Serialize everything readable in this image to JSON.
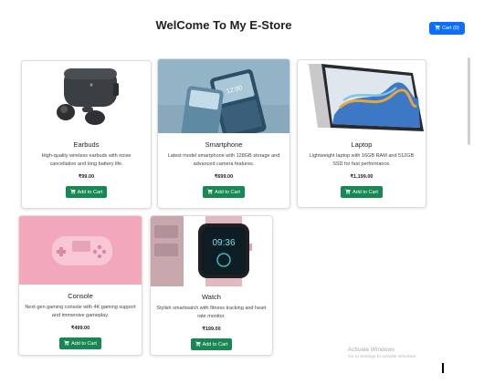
{
  "header": {
    "title": "WelCome To My E-Store",
    "cart_label": "Cart (0)"
  },
  "colors": {
    "primary": "#0d6efd",
    "success": "#198754"
  },
  "products": [
    {
      "title": "Earbuds",
      "description": "High-quality wireless earbuds with noise cancellation and long battery life.",
      "price": "₹99.00",
      "button": "Add to Cart",
      "image": "earbuds-image"
    },
    {
      "title": "Smartphone",
      "description": "Latest model smartphone with 128GB storage and advanced camera features.",
      "price": "₹699.00",
      "button": "Add to Cart",
      "image": "smartphone-image",
      "image_text": "12:00"
    },
    {
      "title": "Laptop",
      "description": "Lightweight laptop with 16GB RAM and 512GB SSD for fast performance.",
      "price": "₹1,199.00",
      "button": "Add to Cart",
      "image": "laptop-image"
    },
    {
      "title": "Console",
      "description": "Next-gen gaming console with 4K gaming support and immersive gameplay.",
      "price": "₹499.00",
      "button": "Add to Cart",
      "image": "console-image"
    },
    {
      "title": "Watch",
      "description": "Stylish smartwatch with fitness tracking and heart rate monitor.",
      "price": "₹199.00",
      "button": "Add to Cart",
      "image": "watch-image",
      "image_text": "09:36"
    }
  ],
  "watermark": {
    "title": "Activate Windows",
    "subtitle": "Go to Settings to activate Windows."
  }
}
